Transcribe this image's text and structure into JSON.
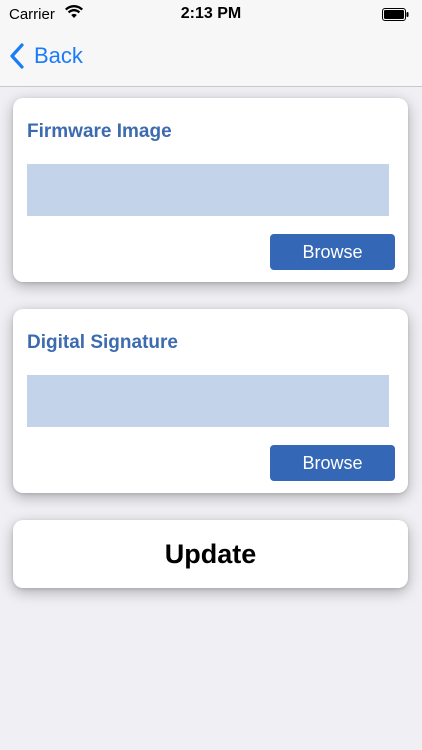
{
  "status_bar": {
    "carrier": "Carrier",
    "time": "2:13 PM"
  },
  "nav": {
    "back_label": "Back"
  },
  "firmware": {
    "title": "Firmware Image",
    "field_value": "",
    "browse_label": "Browse"
  },
  "signature": {
    "title": "Digital Signature",
    "field_value": "",
    "browse_label": "Browse"
  },
  "update": {
    "label": "Update"
  },
  "colors": {
    "accent": "#1a7cf6",
    "title": "#3d6baf",
    "field": "#c3d4ea",
    "button": "#3467b5",
    "background": "#efeff4"
  }
}
